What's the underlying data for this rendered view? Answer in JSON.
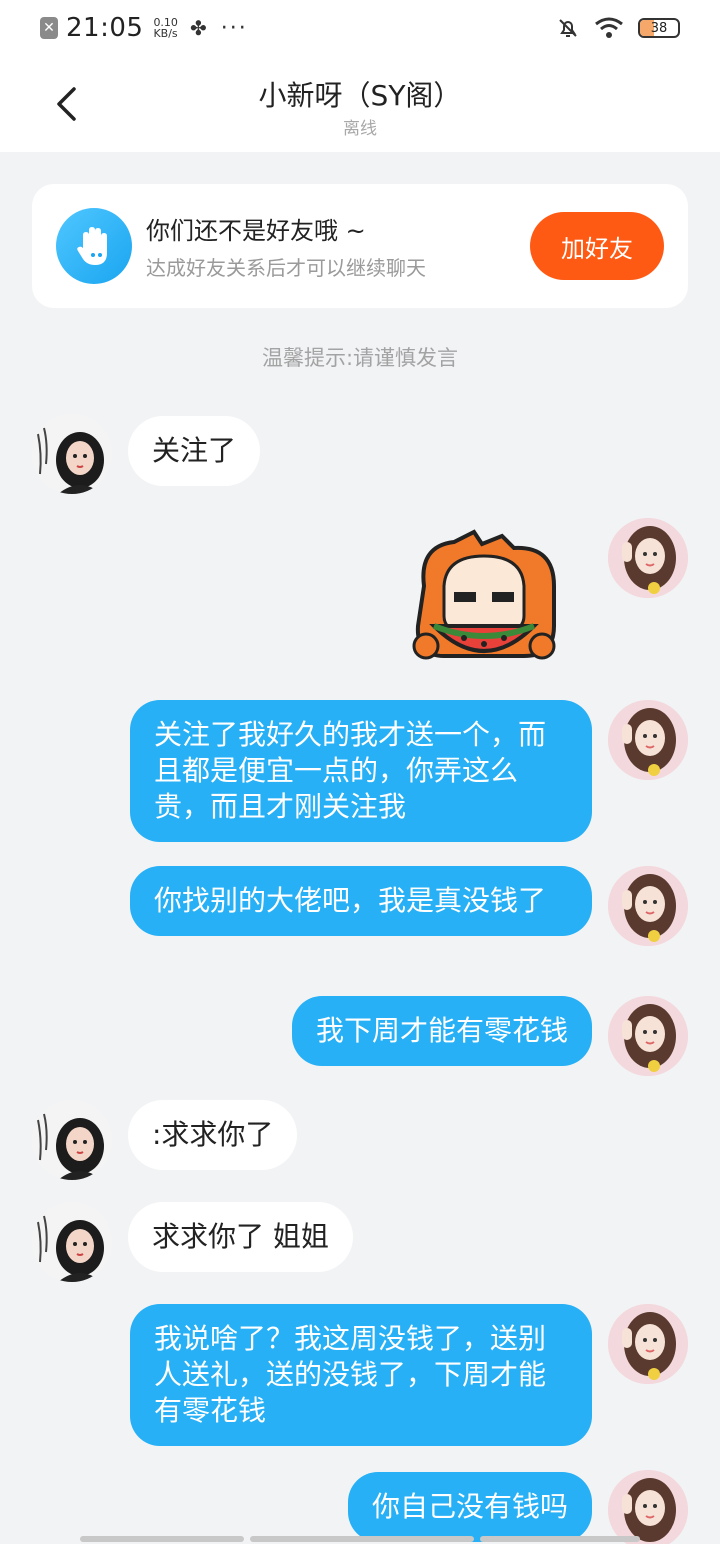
{
  "status_bar": {
    "time": "21:05",
    "net_speed_value": "0.10",
    "net_speed_unit": "KB/s",
    "battery_level": "38",
    "icons": [
      "sim-x-icon",
      "fan-icon",
      "more-dots-icon",
      "mute-bell-icon",
      "wifi-icon",
      "battery-icon"
    ]
  },
  "header": {
    "title": "小新呀（SY阁）",
    "status": "离线",
    "back_icon": "chevron-left-icon"
  },
  "friend_notice": {
    "title": "你们还不是好友哦 ~",
    "subtitle": "达成好友关系后才可以继续聊天",
    "button_label": "加好友",
    "icon": "hand-wave-icon",
    "button_color": "#ff5a14"
  },
  "tip": "温馨提示:请谨慎发言",
  "messages": [
    {
      "side": "in",
      "text": "关注了"
    },
    {
      "side": "out",
      "type": "sticker",
      "icon": "watermelon-sticker"
    },
    {
      "side": "out",
      "text": "关注了我好久的我才送一个，而且都是便宜一点的，你弄这么贵，而且才刚关注我"
    },
    {
      "side": "out",
      "text": "你找别的大佬吧，我是真没钱了"
    },
    {
      "side": "out",
      "text": "我下周才能有零花钱"
    },
    {
      "side": "in",
      "text": ":求求你了"
    },
    {
      "side": "in",
      "text": "求求你了 姐姐"
    },
    {
      "side": "out",
      "text": "我说啥了？我这周没钱了，送别人送礼，送的没钱了，下周才能有零花钱"
    },
    {
      "side": "out",
      "text": "你自己没有钱吗"
    }
  ],
  "colors": {
    "outgoing_bubble": "#27b0f5",
    "incoming_bubble": "#ffffff",
    "background": "#f2f3f5"
  }
}
